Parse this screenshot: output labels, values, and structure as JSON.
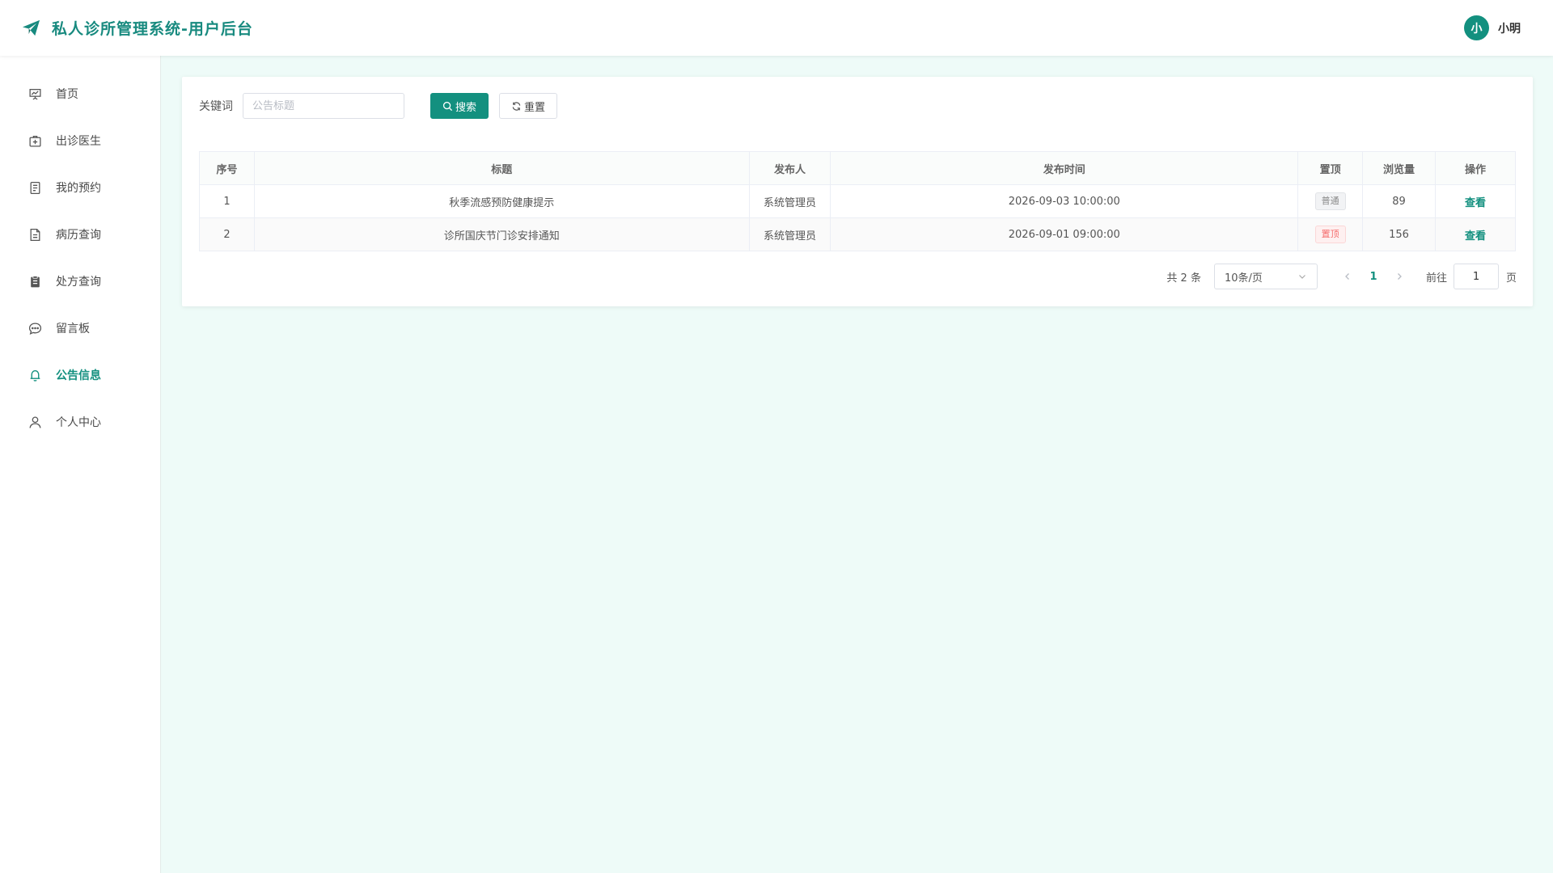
{
  "header": {
    "title": "私人诊所管理系统-用户后台",
    "avatar_char": "小",
    "username": "小明"
  },
  "sidebar": {
    "items": [
      {
        "label": "首页",
        "icon": "presentation-icon"
      },
      {
        "label": "出诊医生",
        "icon": "medical-kit-icon"
      },
      {
        "label": "我的预约",
        "icon": "document-icon"
      },
      {
        "label": "病历查询",
        "icon": "file-icon"
      },
      {
        "label": "处方查询",
        "icon": "clipboard-icon"
      },
      {
        "label": "留言板",
        "icon": "chat-icon"
      },
      {
        "label": "公告信息",
        "icon": "bell-icon",
        "active": true
      },
      {
        "label": "个人中心",
        "icon": "user-icon"
      }
    ]
  },
  "search": {
    "label": "关键词",
    "placeholder": "公告标题",
    "value": "",
    "search_button": "搜索",
    "reset_button": "重置"
  },
  "table": {
    "headers": [
      "序号",
      "标题",
      "发布人",
      "发布时间",
      "置顶",
      "浏览量",
      "操作"
    ],
    "rows": [
      {
        "index": "1",
        "title": "秋季流感预防健康提示",
        "publisher": "系统管理员",
        "time": "2026-09-03 10:00:00",
        "pin": "普通",
        "views": "89",
        "action": "查看"
      },
      {
        "index": "2",
        "title": "诊所国庆节门诊安排通知",
        "publisher": "系统管理员",
        "time": "2026-09-01 09:00:00",
        "pin": "置顶",
        "views": "156",
        "action": "查看"
      }
    ]
  },
  "pagination": {
    "total_text": "共 2 条",
    "page_size": "10条/页",
    "current_page": "1",
    "goto_label": "前往",
    "goto_value": "1",
    "page_unit": "页"
  },
  "colors": {
    "accent": "#13907f",
    "background": "#eefbf8",
    "pin_tag": "#f56c6c"
  }
}
